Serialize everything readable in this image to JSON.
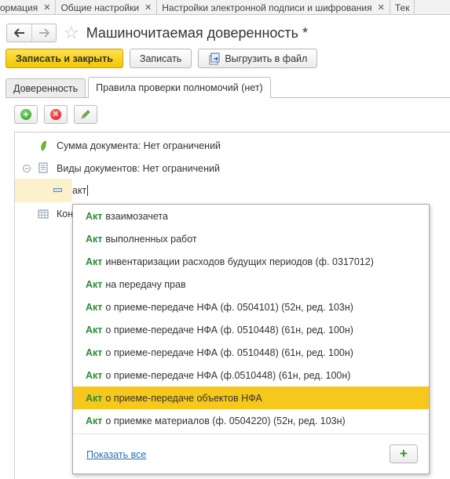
{
  "top_tabs": [
    {
      "label": "формация"
    },
    {
      "label": "Общие настройки"
    },
    {
      "label": "Настройки электронной подписи и шифрования"
    },
    {
      "label": "Тек"
    }
  ],
  "window": {
    "title": "Машиночитаемая доверенность *"
  },
  "toolbar": {
    "save_close_label": "Записать и закрыть",
    "save_label": "Записать",
    "export_label": "Выгрузить в файл"
  },
  "form_tabs": [
    {
      "label": "Доверенность",
      "active": false
    },
    {
      "label": "Правила проверки полномочий (нет)",
      "active": true
    }
  ],
  "tree": {
    "rows": [
      {
        "label": "Сумма документа: Нет ограничений"
      },
      {
        "label": "Виды документов: Нет ограничений"
      }
    ],
    "edit_value": "акт",
    "partial_row_label": "Кон"
  },
  "dropdown": {
    "match_text": "Акт",
    "items": [
      {
        "rest": "взаимозачета"
      },
      {
        "rest": "выполненных работ"
      },
      {
        "rest": "инвентаризации расходов будущих периодов (ф. 0317012)"
      },
      {
        "rest": "на передачу прав"
      },
      {
        "rest": "о приеме-передаче НФА (ф. 0504101) (52н, ред. 103н)"
      },
      {
        "rest": "о приеме-передаче НФА (ф. 0510448) (61н, ред. 100н)"
      },
      {
        "rest": "о приеме-передаче НФА (ф. 0510448) (61н, ред. 100н)"
      },
      {
        "rest": "о приеме-передаче НФА (ф.0510448) (61н, ред. 100н)"
      },
      {
        "rest": "о приеме-передаче объектов НФА",
        "selected": true
      },
      {
        "rest": "о приемке материалов (ф. 0504220) (52н, ред. 103н)"
      }
    ],
    "show_all_label": "Показать все"
  },
  "colors": {
    "primary_button": "#f2c600",
    "selected_item": "#f6c81c",
    "match_text": "#2e8a3a",
    "link": "#2a6fb0"
  }
}
